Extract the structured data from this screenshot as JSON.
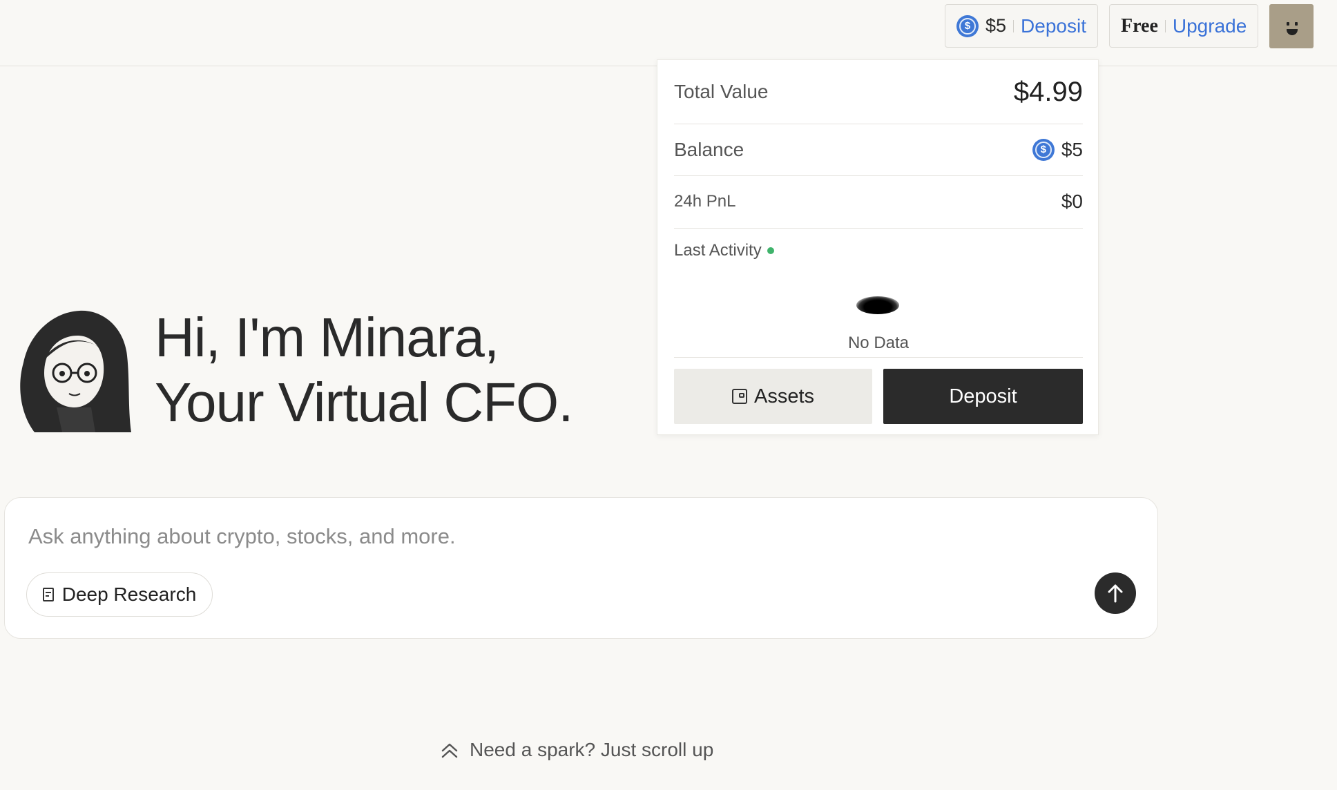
{
  "header": {
    "balance_amount": "$5",
    "deposit_link": "Deposit",
    "plan_label": "Free",
    "upgrade_link": "Upgrade",
    "coin_icon": "usdc-coin-icon",
    "avatar_icon": "smiley-avatar-icon"
  },
  "wallet_panel": {
    "total_value_label": "Total Value",
    "total_value": "$4.99",
    "balance_label": "Balance",
    "balance_value": "$5",
    "pnl_label": "24h PnL",
    "pnl_value": "$0",
    "last_activity_label": "Last Activity",
    "no_data": "No Data",
    "assets_button": "Assets",
    "deposit_button": "Deposit"
  },
  "hero": {
    "line1": "Hi, I'm Minara,",
    "line2": "Your Virtual CFO."
  },
  "chat": {
    "placeholder": "Ask anything about crypto, stocks, and more.",
    "deep_research_label": "Deep Research"
  },
  "footer_hint": "Need a spark? Just scroll up",
  "colors": {
    "accent_link": "#3a72d8",
    "coin": "#3f78d6",
    "activity_dot": "#3fb36b",
    "primary_button": "#2b2b2b",
    "page_bg": "#f9f8f5"
  }
}
